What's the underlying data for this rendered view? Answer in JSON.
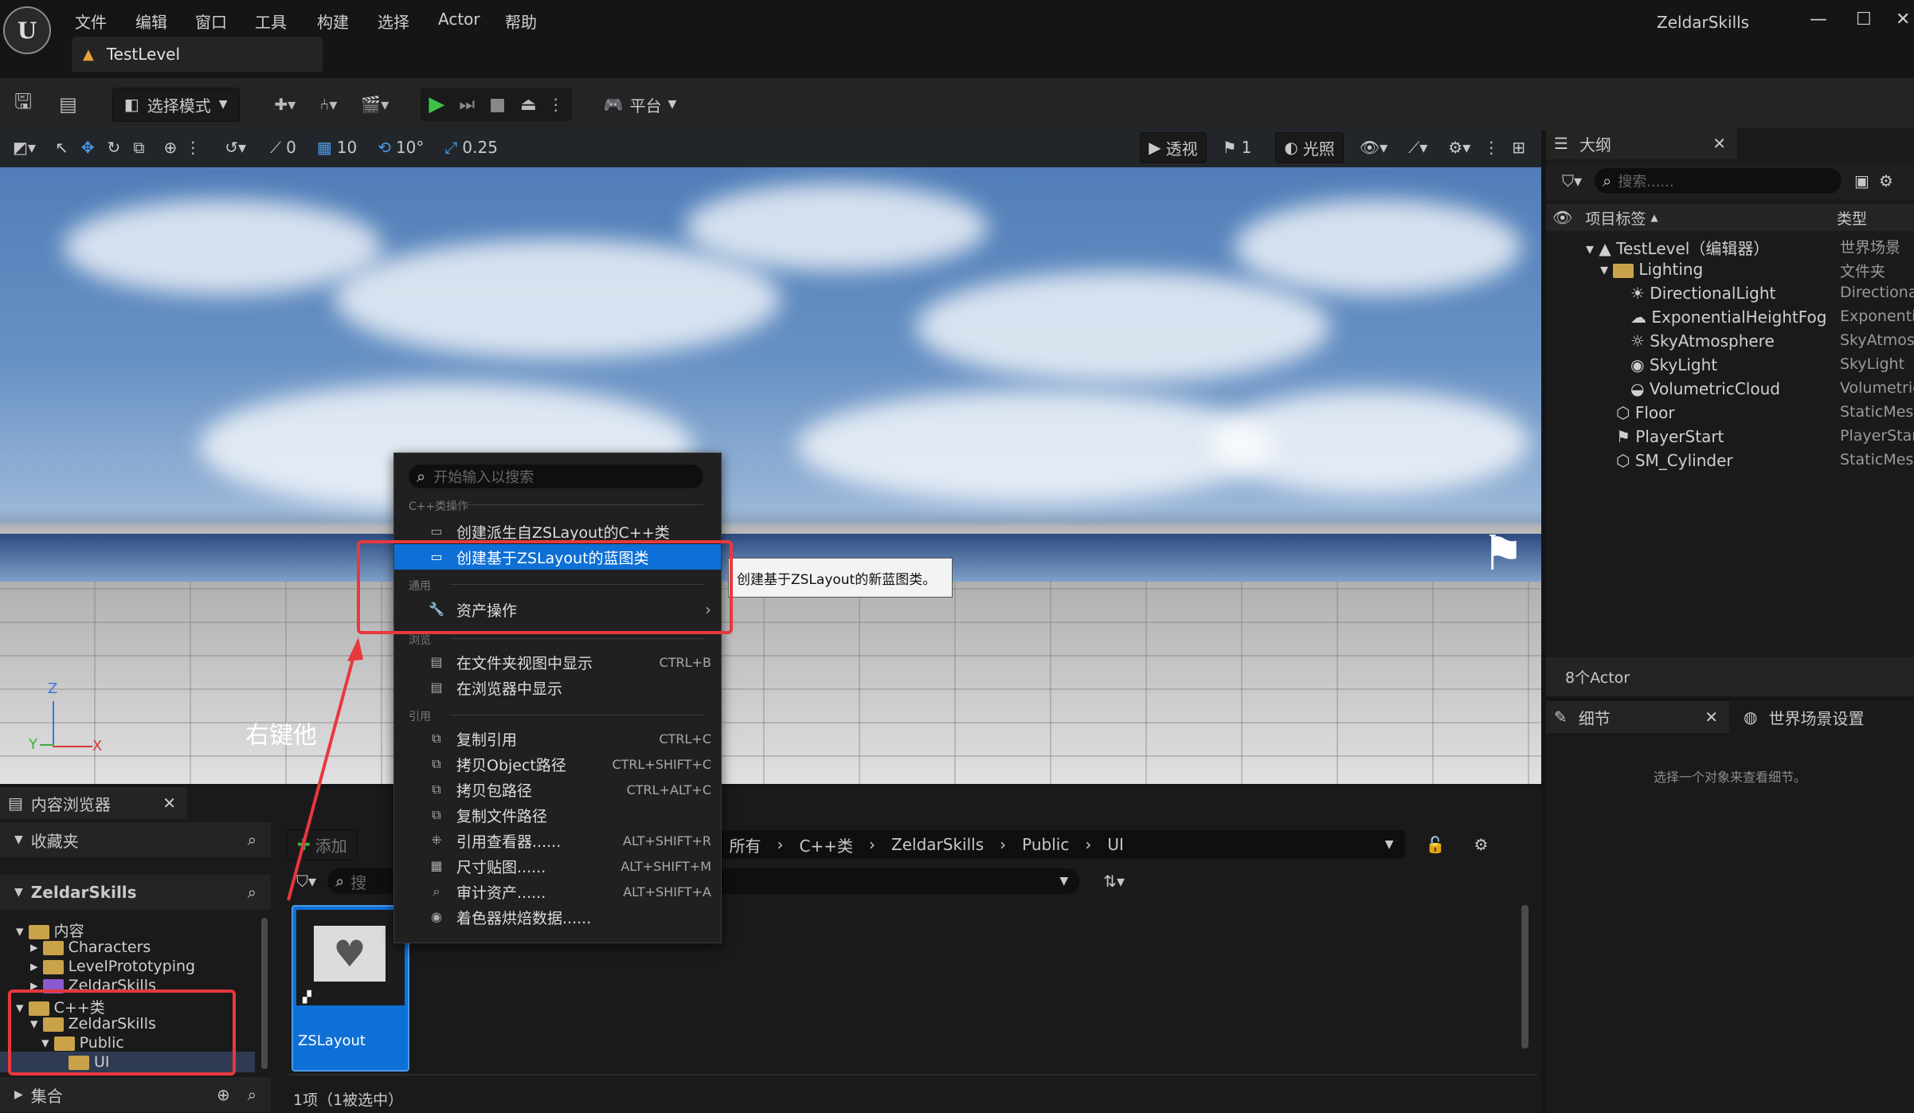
{
  "menu": [
    "文件",
    "编辑",
    "窗口",
    "工具",
    "构建",
    "选择",
    "Actor",
    "帮助"
  ],
  "level_tab": "TestLevel",
  "app_name": "ZeldarSkills",
  "window_controls": {
    "minimize": "—",
    "maximize": "☐",
    "close": "✕"
  },
  "toolbar": {
    "select_mode": "选择模式",
    "platform": "平台"
  },
  "viewport_toolbar": {
    "rotation_snap": "0",
    "grid_snap": "10",
    "angle_snap": "10°",
    "scale_snap": "0.25",
    "view_mode": "透视",
    "cam_speed": "1",
    "lighting": "光照"
  },
  "viewport_annotation": "右键他",
  "axis": {
    "x": "X",
    "y": "Y",
    "z": "Z"
  },
  "context_menu": {
    "search_placeholder": "开始输入以搜索",
    "section_cpp": "C++类操作",
    "create_derived": "创建派生自ZSLayout的C++类",
    "create_blueprint": "创建基于ZSLayout的蓝图类",
    "section_common": "通用",
    "asset_actions": "资产操作",
    "section_browse": "浏览",
    "show_in_folder": "在文件夹视图中显示",
    "show_in_folder_sc": "CTRL+B",
    "show_in_explorer": "在浏览器中显示",
    "section_ref": "引用",
    "copy_ref": "复制引用",
    "copy_ref_sc": "CTRL+C",
    "copy_obj_path": "拷贝Object路径",
    "copy_obj_path_sc": "CTRL+SHIFT+C",
    "copy_pkg_path": "拷贝包路径",
    "copy_pkg_path_sc": "CTRL+ALT+C",
    "copy_file_path": "复制文件路径",
    "ref_viewer": "引用查看器......",
    "ref_viewer_sc": "ALT+SHIFT+R",
    "size_map": "尺寸贴图......",
    "size_map_sc": "ALT+SHIFT+M",
    "audit": "审计资产......",
    "audit_sc": "ALT+SHIFT+A",
    "shader_cook": "着色器烘焙数据......"
  },
  "tooltip": "创建基于ZSLayout的新蓝图类。",
  "outliner": {
    "tab": "大纲",
    "search_placeholder": "搜索......",
    "col_label": "项目标签",
    "col_type": "类型",
    "items": [
      {
        "label": "TestLevel（编辑器）",
        "type": "世界场景"
      },
      {
        "label": "Lighting",
        "type": "文件夹"
      },
      {
        "label": "DirectionalLight",
        "type": "Directiona"
      },
      {
        "label": "ExponentialHeightFog",
        "type": "Exponenti"
      },
      {
        "label": "SkyAtmosphere",
        "type": "SkyAtmos"
      },
      {
        "label": "SkyLight",
        "type": "SkyLight"
      },
      {
        "label": "VolumetricCloud",
        "type": "Volumetric"
      },
      {
        "label": "Floor",
        "type": "StaticMes"
      },
      {
        "label": "PlayerStart",
        "type": "PlayerStar"
      },
      {
        "label": "SM_Cylinder",
        "type": "StaticMes"
      }
    ],
    "count": "8个Actor"
  },
  "details": {
    "tab": "细节",
    "world_tab": "世界场景设置",
    "empty_msg": "选择一个对象来查看细节。"
  },
  "content_browser": {
    "tab": "内容浏览器",
    "favorites": "收藏夹",
    "project": "ZeldarSkills",
    "add": "添加",
    "search_placeholder": "搜",
    "tree": [
      "内容",
      "Characters",
      "LevelPrototyping",
      "ZeldarSkills",
      "C++类",
      "ZeldarSkills",
      "Public",
      "UI"
    ],
    "breadcrumb": [
      "所有",
      "C++类",
      "ZeldarSkills",
      "Public",
      "UI"
    ],
    "asset_name": "ZSLayout",
    "collections": "集合",
    "status": "1项（1被选中）"
  }
}
